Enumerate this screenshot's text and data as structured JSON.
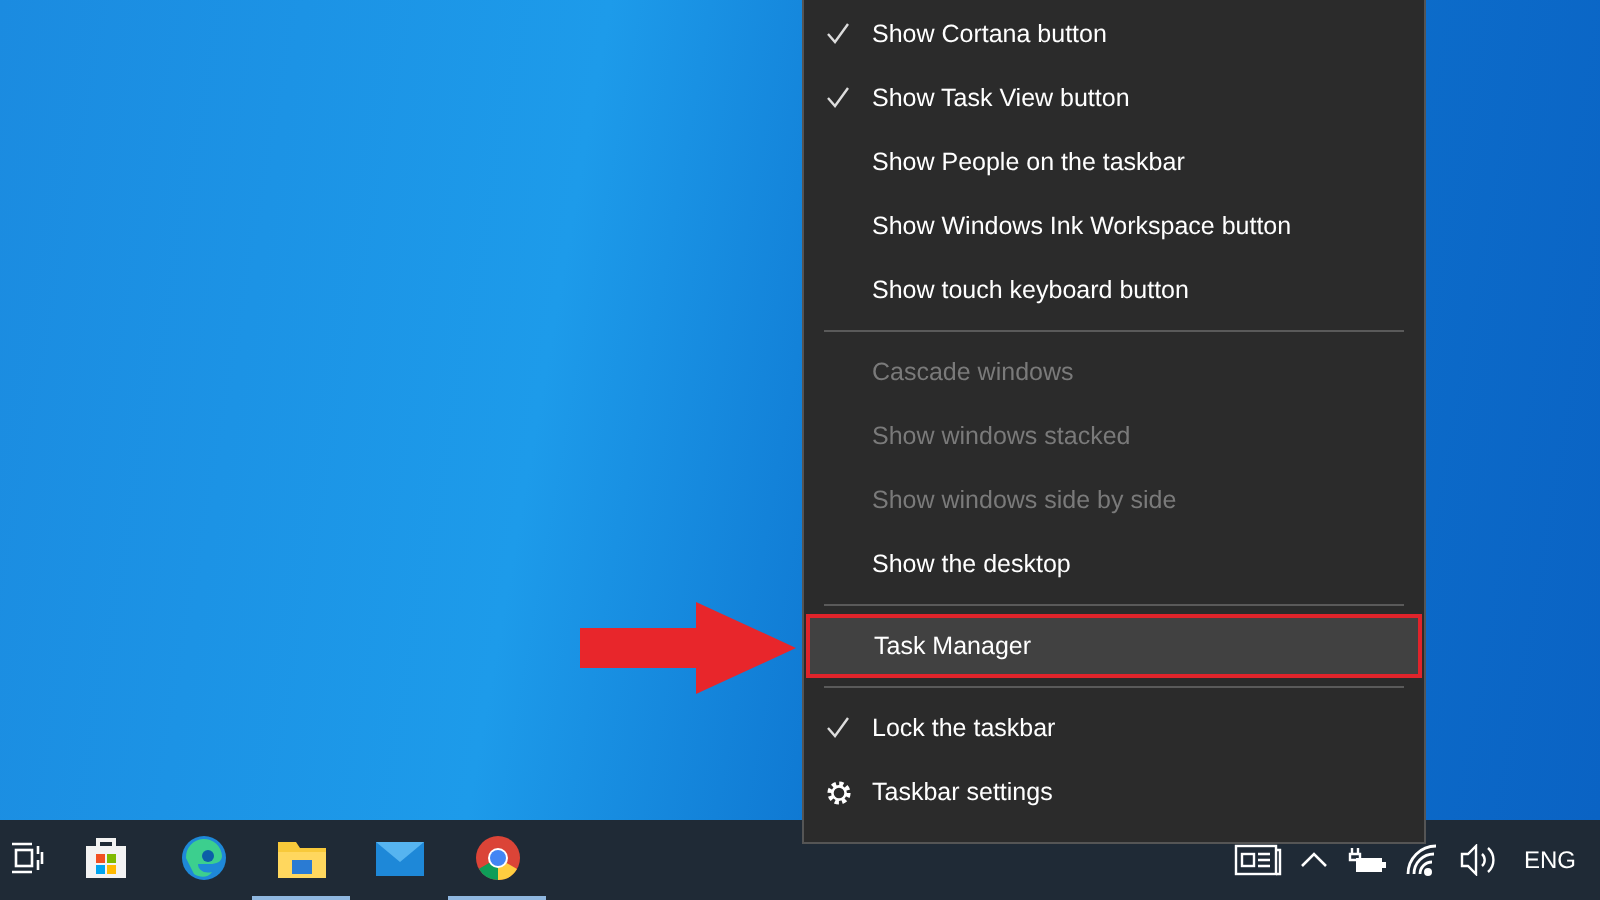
{
  "context_menu": {
    "groups": [
      {
        "items": [
          {
            "kind": "toggle",
            "label": "Show Cortana button",
            "checked": true,
            "disabled": false,
            "selected": false
          },
          {
            "kind": "toggle",
            "label": "Show Task View button",
            "checked": true,
            "disabled": false,
            "selected": false
          },
          {
            "kind": "toggle",
            "label": "Show People on the taskbar",
            "checked": false,
            "disabled": false,
            "selected": false
          },
          {
            "kind": "toggle",
            "label": "Show Windows Ink Workspace button",
            "checked": false,
            "disabled": false,
            "selected": false
          },
          {
            "kind": "toggle",
            "label": "Show touch keyboard button",
            "checked": false,
            "disabled": false,
            "selected": false
          }
        ]
      },
      {
        "items": [
          {
            "kind": "command",
            "label": "Cascade windows",
            "disabled": true,
            "selected": false
          },
          {
            "kind": "command",
            "label": "Show windows stacked",
            "disabled": true,
            "selected": false
          },
          {
            "kind": "command",
            "label": "Show windows side by side",
            "disabled": true,
            "selected": false
          },
          {
            "kind": "command",
            "label": "Show the desktop",
            "disabled": false,
            "selected": false
          }
        ]
      },
      {
        "items": [
          {
            "kind": "command",
            "label": "Task Manager",
            "disabled": false,
            "selected": true
          }
        ]
      },
      {
        "items": [
          {
            "kind": "toggle",
            "label": "Lock the taskbar",
            "checked": true,
            "disabled": false,
            "selected": false
          },
          {
            "kind": "settings",
            "label": "Taskbar settings",
            "disabled": false,
            "selected": false
          }
        ]
      }
    ]
  },
  "taskbar": {
    "apps": [
      {
        "kind": "taskview",
        "running": false
      },
      {
        "kind": "store",
        "running": false
      },
      {
        "kind": "edge",
        "running": false
      },
      {
        "kind": "explorer",
        "running": true
      },
      {
        "kind": "mail",
        "running": false
      },
      {
        "kind": "chrome",
        "running": true
      }
    ],
    "tray": {
      "icons": [
        {
          "kind": "news"
        },
        {
          "kind": "chevron"
        },
        {
          "kind": "battery"
        },
        {
          "kind": "wifi"
        },
        {
          "kind": "volume"
        }
      ],
      "language": "ENG"
    }
  }
}
